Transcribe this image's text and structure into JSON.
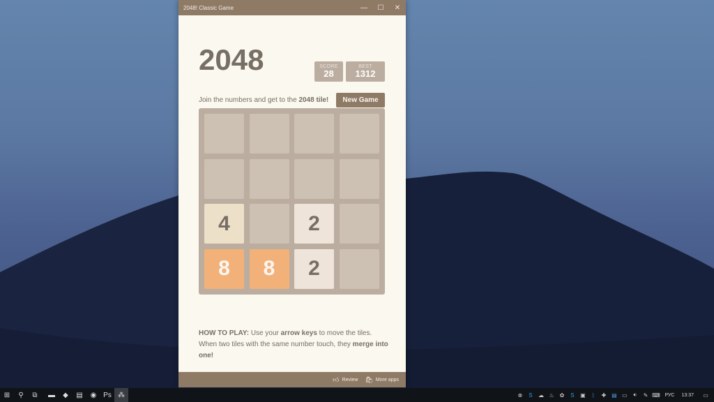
{
  "window": {
    "title": "2048! Classic Game",
    "controls": {
      "minimize": "—",
      "maximize": "☐",
      "close": "✕"
    }
  },
  "game": {
    "logo": "2048",
    "score_label": "SCORE",
    "score_value": "28",
    "best_label": "BEST",
    "best_value": "1312",
    "intro_prefix": "Join the numbers and get to the ",
    "intro_bold": "2048 tile!",
    "new_game_label": "New Game",
    "board": [
      [
        "",
        "",
        "",
        ""
      ],
      [
        "",
        "",
        "",
        ""
      ],
      [
        "4",
        "",
        "2",
        ""
      ],
      [
        "8",
        "8",
        "2",
        ""
      ]
    ],
    "howto": {
      "p1": "HOW TO PLAY:",
      "p2": " Use your ",
      "p3": "arrow keys",
      "p4": " to move the tiles. When two tiles with the same number touch, they ",
      "p5": "merge into one!"
    }
  },
  "footer": {
    "review_label": "Review",
    "more_apps_label": "More apps"
  },
  "taskbar": {
    "apps": [
      {
        "name": "start",
        "glyph": "⊞"
      },
      {
        "name": "search",
        "glyph": "⚲"
      },
      {
        "name": "task-view",
        "glyph": "⧉"
      },
      {
        "name": "file-explorer",
        "glyph": "▬"
      },
      {
        "name": "visual-studio",
        "glyph": "◆"
      },
      {
        "name": "notepad",
        "glyph": "▤"
      },
      {
        "name": "chrome",
        "glyph": "◉"
      },
      {
        "name": "photoshop",
        "glyph": "Ps"
      },
      {
        "name": "2048-app",
        "glyph": "⁂"
      }
    ],
    "tray": {
      "language": "РУС",
      "time": "13:37"
    }
  }
}
